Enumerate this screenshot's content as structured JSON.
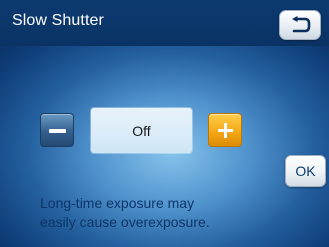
{
  "header": {
    "title": "Slow Shutter",
    "back_icon": "return-arrow-icon"
  },
  "setting": {
    "value": "Off",
    "decrease_icon": "minus-icon",
    "increase_icon": "plus-icon"
  },
  "ok_label": "OK",
  "message": {
    "line1": "Long-time exposure may",
    "line2": "easily cause overexposure."
  },
  "colors": {
    "header": "#0b3768",
    "background": "#3a7cbc",
    "minus_button": "#335f8e",
    "plus_button": "#f2a514",
    "message_text": "#0e3566"
  }
}
